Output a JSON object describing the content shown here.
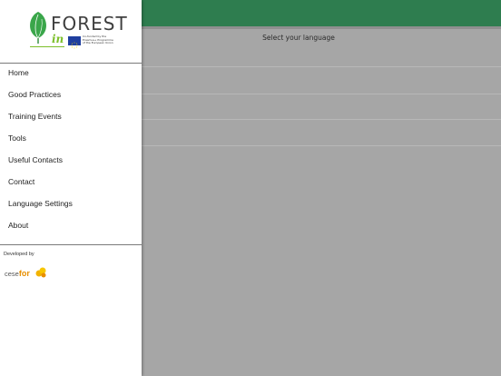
{
  "main": {
    "heading": "Select your language",
    "rows": [
      "",
      "",
      "",
      ""
    ]
  },
  "drawer": {
    "logo": {
      "word_forest": "FOREST",
      "word_in": "in",
      "eu_text": "Co-funded by the Erasmus+ Programme of the European Union"
    },
    "menu": [
      {
        "label": "Home"
      },
      {
        "label": "Good Practices"
      },
      {
        "label": "Training Events"
      },
      {
        "label": "Tools"
      },
      {
        "label": "Useful Contacts"
      },
      {
        "label": "Contact"
      },
      {
        "label": "Language Settings"
      },
      {
        "label": "About"
      }
    ],
    "developed_by": "Developed by",
    "dev_logo": {
      "prefix": "cese",
      "brand": "for"
    }
  },
  "colors": {
    "header": "#2e7d4f",
    "overlay": "#a6a6a6",
    "accent_green": "#7cbf2a",
    "cesefor_orange": "#e88f00"
  }
}
